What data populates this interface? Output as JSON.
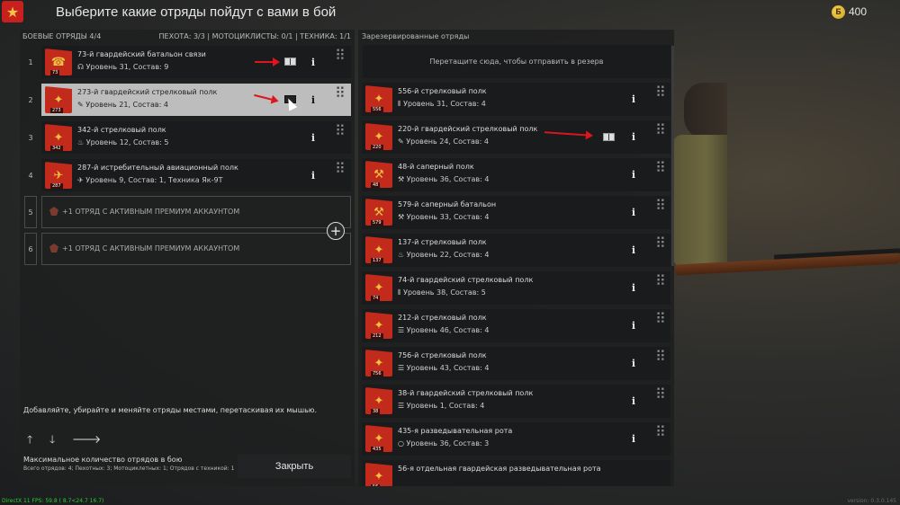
{
  "header": {
    "title": "Выберите какие отряды пойдут с вами в бой",
    "currency": "400",
    "coin_symbol": "Б"
  },
  "left": {
    "combat_label": "БОЕВЫЕ ОТРЯДЫ 4/4",
    "counts_label": "ПЕХОТА: 3/3 | МОТОЦИКЛИСТЫ: 0/1 | ТЕХНИКА: 1/1",
    "slots": [
      {
        "num": "1",
        "name": "73-й гвардейский батальон связи",
        "level": "Уровень 31, Состав: 9",
        "tag": "73",
        "icon": "headset-icon",
        "icon_glyph": "☊",
        "emblem": "☎"
      },
      {
        "num": "2",
        "name": "273-й гвардейский стрелковый полк",
        "level": "Уровень 21, Состав: 4",
        "tag": "273",
        "icon": "wrench-icon",
        "icon_glyph": "✎",
        "emblem": "✦"
      },
      {
        "num": "3",
        "name": "342-й стрелковый полк",
        "level": "Уровень 12, Состав: 5",
        "tag": "342",
        "icon": "flame-icon",
        "icon_glyph": "♨",
        "emblem": "✦"
      },
      {
        "num": "4",
        "name": "287-й истребительный авиационный полк",
        "level": "Уровень 9, Состав: 1, Техника Як-9Т",
        "tag": "287",
        "icon": "plane-icon",
        "icon_glyph": "✈",
        "emblem": "✈"
      }
    ],
    "premium_slots": [
      {
        "num": "5",
        "label": "+1 ОТРЯД С АКТИВНЫМ ПРЕМИУМ АККАУНТОМ"
      },
      {
        "num": "6",
        "label": "+1 ОТРЯД С АКТИВНЫМ ПРЕМИУМ АККАУНТОМ"
      }
    ],
    "hint": "Добавляйте, убирайте и меняйте отряды местами, перетаскивая их мышью.",
    "arrow_up": "🡑",
    "arrow_down": "🡓",
    "arrow_right": "🡒",
    "max_title": "Максимальное количество отрядов в бою",
    "max_detail": "Всего отрядов: 4; Пехотных: 3; Мотоциклетных: 1; Отрядов с техникой: 1",
    "close_label": "Закрыть"
  },
  "right": {
    "reserve_label": "Зарезервированные отряды",
    "dropzone": "Перетащите сюда, чтобы отправить в резерв",
    "rows": [
      {
        "name": "556-й стрелковый полк",
        "level": "Уровень 31, Состав: 4",
        "tag": "556",
        "icon_glyph": "⦀",
        "emblem": "✦"
      },
      {
        "name": "220-й гвардейский стрелковый полк",
        "level": "Уровень 24, Состав: 4",
        "tag": "220",
        "icon_glyph": "✎",
        "emblem": "✦"
      },
      {
        "name": "48-й саперный полк",
        "level": "Уровень 36, Состав: 4",
        "tag": "48",
        "icon_glyph": "⚒",
        "emblem": "⚒"
      },
      {
        "name": "579-й саперный батальон",
        "level": "Уровень 33, Состав: 4",
        "tag": "579",
        "icon_glyph": "⚒",
        "emblem": "⚒"
      },
      {
        "name": "137-й стрелковый полк",
        "level": "Уровень 22, Состав: 4",
        "tag": "137",
        "icon_glyph": "♨",
        "emblem": "✦"
      },
      {
        "name": "74-й гвардейский стрелковый полк",
        "level": "Уровень 38, Состав: 5",
        "tag": "74",
        "icon_glyph": "⦀",
        "emblem": "✦"
      },
      {
        "name": "212-й стрелковый полк",
        "level": "Уровень 46, Состав: 4",
        "tag": "212",
        "icon_glyph": "☰",
        "emblem": "✦"
      },
      {
        "name": "756-й стрелковый полк",
        "level": "Уровень 43, Состав: 4",
        "tag": "756",
        "icon_glyph": "☰",
        "emblem": "✦"
      },
      {
        "name": "38-й гвардейский стрелковый полк",
        "level": "Уровень 1, Состав: 4",
        "tag": "38",
        "icon_glyph": "☰",
        "emblem": "✦"
      },
      {
        "name": "435-я разведывательная рота",
        "level": "Уровень 36, Состав: 3",
        "tag": "435",
        "icon_glyph": "○",
        "emblem": "✦"
      },
      {
        "name": "56-я отдельная гвардейская разведывательная рота",
        "level": "",
        "tag": "56",
        "icon_glyph": "",
        "emblem": "✦"
      }
    ]
  },
  "footer": {
    "left": "DirectX 11 FPS: 59.8 ( 8.7<24.7 16.7)",
    "right": "version: 0.3.0.145"
  },
  "colors": {
    "accent_red": "#c22a1c",
    "arrow_red": "#e0141c",
    "selected_row": "#bdbdbd"
  }
}
